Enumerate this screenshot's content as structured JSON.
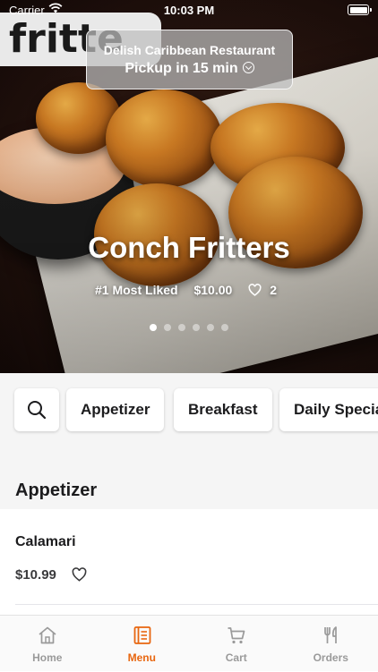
{
  "status_bar": {
    "carrier": "Carrier",
    "time": "10:03 PM"
  },
  "logo": {
    "text": "fritte"
  },
  "pickup": {
    "restaurant": "Delish Caribbean Restaurant",
    "time_label": "Pickup in 15 min"
  },
  "hero": {
    "title": "Conch Fritters",
    "badge": "#1 Most Liked",
    "price": "$10.00",
    "likes": "2",
    "slide_count": 6,
    "active_slide": 1
  },
  "categories": [
    "Appetizer",
    "Breakfast",
    "Daily Special"
  ],
  "section": {
    "title": "Appetizer"
  },
  "items": [
    {
      "name": "Calamari",
      "price": "$10.99"
    }
  ],
  "tabs": [
    {
      "label": "Home",
      "icon": "home-icon"
    },
    {
      "label": "Menu",
      "icon": "menu-book-icon",
      "active": true
    },
    {
      "label": "Cart",
      "icon": "cart-icon"
    },
    {
      "label": "Orders",
      "icon": "fork-knife-icon"
    }
  ],
  "colors": {
    "accent": "#e8660f",
    "inactive": "#9a9a9a",
    "surface": "#f5f5f5"
  }
}
